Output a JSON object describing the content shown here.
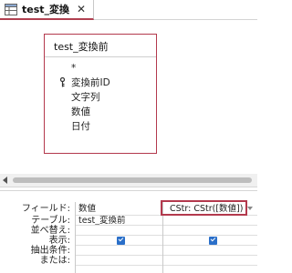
{
  "tab": {
    "title": "test_変換",
    "icon": "table-query-icon",
    "close_glyph": "✕"
  },
  "table_box": {
    "title": "test_変換前",
    "fields": [
      {
        "label": "*",
        "primary_key": false
      },
      {
        "label": "変換前ID",
        "primary_key": true
      },
      {
        "label": "文字列",
        "primary_key": false
      },
      {
        "label": "数値",
        "primary_key": false
      },
      {
        "label": "日付",
        "primary_key": false
      }
    ]
  },
  "grid": {
    "row_labels": [
      "フィールド:",
      "テーブル:",
      "並べ替え:",
      "表示:",
      "抽出条件:",
      "または:"
    ],
    "columns": [
      {
        "field": "数値",
        "table": "test_変換前",
        "sort": "",
        "show": true,
        "criteria": "",
        "or": ""
      },
      {
        "field": "CStr: CStr([数値])",
        "table": "",
        "sort": "",
        "show": true,
        "criteria": "",
        "or": ""
      }
    ]
  },
  "colors": {
    "accent": "#b3394d",
    "checkbox": "#2a6fc9"
  }
}
